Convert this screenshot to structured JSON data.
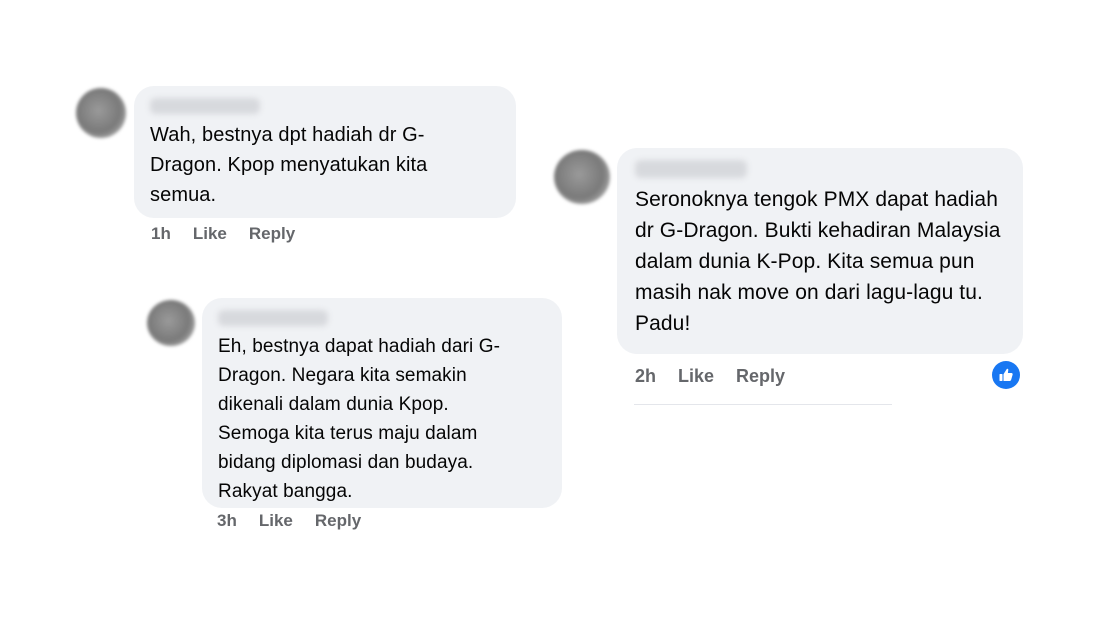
{
  "comments": [
    {
      "text": "Wah, bestnya dpt hadiah dr G-Dragon. Kpop menyatukan kita semua.",
      "time": "1h",
      "like_label": "Like",
      "reply_label": "Reply"
    },
    {
      "text": "Eh, bestnya dapat hadiah dari G-Dragon. Negara kita semakin dikenali dalam dunia Kpop. Semoga kita terus maju dalam bidang diplomasi dan budaya. Rakyat bangga.",
      "time": "3h",
      "like_label": "Like",
      "reply_label": "Reply"
    },
    {
      "text": "Seronoknya tengok PMX dapat hadiah dr G-Dragon. Bukti kehadiran Malaysia dalam dunia K-Pop. Kita semua pun masih nak move on dari lagu-lagu tu. Padu!",
      "time": "2h",
      "like_label": "Like",
      "reply_label": "Reply",
      "reaction_icon": "thumbs-up-icon"
    }
  ],
  "colors": {
    "bubble": "#f0f2f5",
    "meta": "#65676b",
    "like_reaction": "#1877f2"
  }
}
